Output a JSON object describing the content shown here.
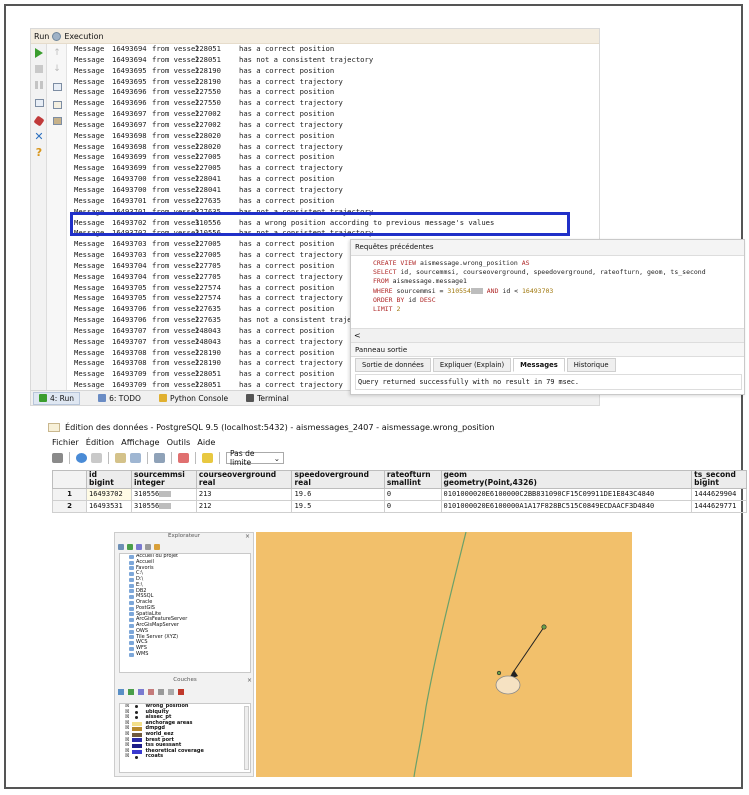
{
  "run": {
    "title_prefix": "Run",
    "title": "Execution",
    "log_rows": [
      [
        "Message",
        "16493694",
        "from vessel",
        "228051",
        "has a correct position"
      ],
      [
        "Message",
        "16493694",
        "from vessel",
        "228051",
        "has not a consistent trajectory"
      ],
      [
        "Message",
        "16493695",
        "from vessel",
        "228190",
        "has a correct position"
      ],
      [
        "Message",
        "16493695",
        "from vessel",
        "228190",
        "has a correct trajectory"
      ],
      [
        "Message",
        "16493696",
        "from vessel",
        "227550",
        "has a correct position"
      ],
      [
        "Message",
        "16493696",
        "from vessel",
        "227550",
        "has a correct trajectory"
      ],
      [
        "Message",
        "16493697",
        "from vessel",
        "227002",
        "has a correct position"
      ],
      [
        "Message",
        "16493697",
        "from vessel",
        "227002",
        "has a correct trajectory"
      ],
      [
        "Message",
        "16493698",
        "from vessel",
        "228020",
        "has a correct position"
      ],
      [
        "Message",
        "16493698",
        "from vessel",
        "228020",
        "has a correct trajectory"
      ],
      [
        "Message",
        "16493699",
        "from vessel",
        "227005",
        "has a correct position"
      ],
      [
        "Message",
        "16493699",
        "from vessel",
        "227005",
        "has a correct trajectory"
      ],
      [
        "Message",
        "16493700",
        "from vessel",
        "228041",
        "has a correct position"
      ],
      [
        "Message",
        "16493700",
        "from vessel",
        "228041",
        "has a correct trajectory"
      ],
      [
        "Message",
        "16493701",
        "from vessel",
        "227635",
        "has a correct position"
      ],
      [
        "Message",
        "16493701",
        "from vessel",
        "227635",
        "has not a consistent trajectory"
      ],
      [
        "Message",
        "16493702",
        "from vessel",
        "310556",
        "has a wrong position according to previous message's values"
      ],
      [
        "Message",
        "16493702",
        "from vessel",
        "310556",
        "has not a consistent trajectory"
      ],
      [
        "Message",
        "16493703",
        "from vessel",
        "227005",
        "has a correct position"
      ],
      [
        "Message",
        "16493703",
        "from vessel",
        "227005",
        "has a correct trajectory"
      ],
      [
        "Message",
        "16493704",
        "from vessel",
        "227705",
        "has a correct position"
      ],
      [
        "Message",
        "16493704",
        "from vessel",
        "227705",
        "has a correct trajectory"
      ],
      [
        "Message",
        "16493705",
        "from vessel",
        "227574",
        "has a correct position"
      ],
      [
        "Message",
        "16493705",
        "from vessel",
        "227574",
        "has a correct trajectory"
      ],
      [
        "Message",
        "16493706",
        "from vessel",
        "227635",
        "has a correct position"
      ],
      [
        "Message",
        "16493706",
        "from vessel",
        "227635",
        "has not a consistent trajectory"
      ],
      [
        "Message",
        "16493707",
        "from vessel",
        "248043",
        "has a correct position"
      ],
      [
        "Message",
        "16493707",
        "from vessel",
        "248043",
        "has a correct trajectory"
      ],
      [
        "Message",
        "16493708",
        "from vessel",
        "228190",
        "has a correct position"
      ],
      [
        "Message",
        "16493708",
        "from vessel",
        "228190",
        "has a correct trajectory"
      ],
      [
        "Message",
        "16493709",
        "from vessel",
        "228051",
        "has a correct position"
      ],
      [
        "Message",
        "16493709",
        "from vessel",
        "228051",
        "has a correct trajectory"
      ]
    ],
    "bottom_tabs": [
      {
        "label": "4: Run",
        "color": "#3a9d2e"
      },
      {
        "label": "6: TODO",
        "color": "#6a8cc4"
      },
      {
        "label": "Python Console",
        "color": "#e0b030"
      },
      {
        "label": "Terminal",
        "color": "#555555"
      }
    ]
  },
  "requetes": {
    "title": "Requêtes précédentes",
    "sql_line1_kw": "CREATE VIEW",
    "sql_line1_rest": " aismessage.wrong_position ",
    "sql_line1_kw2": "AS",
    "sql_line2_kw": "SELECT",
    "sql_line2_rest": " id, sourcemmsi, courseoverground, speedoverground, rateofturn, geom, ts_second",
    "sql_line3_kw": "FROM",
    "sql_line3_rest": " aismessage.message1",
    "sql_line4_kw": "WHERE",
    "sql_line4_a": " sourcemmsi = ",
    "sql_line4_num": "310554",
    "sql_line4_kw2": " AND",
    "sql_line4_b": " id < ",
    "sql_line4_num2": "16493703",
    "sql_line5_kw": "ORDER BY",
    "sql_line5_rest": " id ",
    "sql_line5_kw2": "DESC",
    "sql_line6_kw": "LIMIT",
    "sql_line6_num": " 2",
    "scroll_arrow": "<",
    "panel_title": "Panneau sortie",
    "tabs": [
      "Sortie de données",
      "Expliquer (Explain)",
      "Messages",
      "Historique"
    ],
    "message": "Query returned successfully with no result in 79 msec."
  },
  "edition": {
    "title": "Édition des données - PostgreSQL 9.5 (localhost:5432) - aismessages_2407 - aismessage.wrong_position",
    "menu": [
      "Fichier",
      "Édition",
      "Affichage",
      "Outils",
      "Aide"
    ],
    "limit_label": "Pas de limite",
    "columns": [
      {
        "name": "id",
        "type": "bigint"
      },
      {
        "name": "sourcemmsi",
        "type": "integer"
      },
      {
        "name": "courseoverground",
        "type": "real"
      },
      {
        "name": "speedoverground",
        "type": "real"
      },
      {
        "name": "rateofturn",
        "type": "smallint"
      },
      {
        "name": "geom",
        "type": "geometry(Point,4326)"
      },
      {
        "name": "ts_second",
        "type": "bigint"
      }
    ],
    "rows": [
      {
        "n": "1",
        "id": "16493702",
        "mmsi": "310556",
        "cog": "213",
        "sog": "19.6",
        "rot": "0",
        "geom": "0101000020E6100000C2BB831090CF15C09911DE1E843C4840",
        "ts": "1444629904"
      },
      {
        "n": "2",
        "id": "16493531",
        "mmsi": "310556",
        "cog": "212",
        "sog": "19.5",
        "rot": "0",
        "geom": "0101000020E6100000A1A17F828BC515C0849ECDAACF3D4840",
        "ts": "1444629771"
      }
    ]
  },
  "qgis": {
    "explorer_title": "Explorateur",
    "couches_title": "Couches",
    "close_glyph": "×",
    "browser_items": [
      {
        "label": "Accueil du projet",
        "lvl": 1
      },
      {
        "label": "Accueil",
        "lvl": 1
      },
      {
        "label": "Favoris",
        "lvl": 1
      },
      {
        "label": "C:\\",
        "lvl": 1
      },
      {
        "label": "D:\\",
        "lvl": 1
      },
      {
        "label": "E:\\",
        "lvl": 1
      },
      {
        "label": "DB2",
        "lvl": 1
      },
      {
        "label": "MSSQL",
        "lvl": 1
      },
      {
        "label": "Oracle",
        "lvl": 1
      },
      {
        "label": "PostGIS",
        "lvl": 1
      },
      {
        "label": "SpatiaLite",
        "lvl": 1
      },
      {
        "label": "ArcGisFeatureServer",
        "lvl": 1
      },
      {
        "label": "ArcGisMapServer",
        "lvl": 1
      },
      {
        "label": "OWS",
        "lvl": 1
      },
      {
        "label": "Tile Server (XYZ)",
        "lvl": 1
      },
      {
        "label": "WCS",
        "lvl": 1
      },
      {
        "label": "WFS",
        "lvl": 1
      },
      {
        "label": "WMS",
        "lvl": 1
      }
    ],
    "layers": [
      {
        "label": "wrong_position",
        "kind": "dot",
        "color": "#222222"
      },
      {
        "label": "ubiquity",
        "kind": "dot",
        "color": "#222222"
      },
      {
        "label": "aissec_pt",
        "kind": "dot",
        "color": "#222222"
      },
      {
        "label": "anchorage areas",
        "kind": "sw",
        "color": "#f4e08a"
      },
      {
        "label": "dmpgd",
        "kind": "sw",
        "color": "#b88a2a"
      },
      {
        "label": "world_eez",
        "kind": "sw",
        "color": "#6f5a3e"
      },
      {
        "label": "brest port",
        "kind": "sw",
        "color": "#2b2ba8"
      },
      {
        "label": "tss ouessant",
        "kind": "sw",
        "color": "#1d1d88"
      },
      {
        "label": "theoretical coverage",
        "kind": "sw",
        "color": "#3a3ad0"
      },
      {
        "label": "rcoats",
        "kind": "dot",
        "color": "#222222"
      }
    ],
    "map_colors": {
      "background": "#f2c06b",
      "line": "#6aa06a",
      "ellipse": "#f6e2c2"
    }
  }
}
